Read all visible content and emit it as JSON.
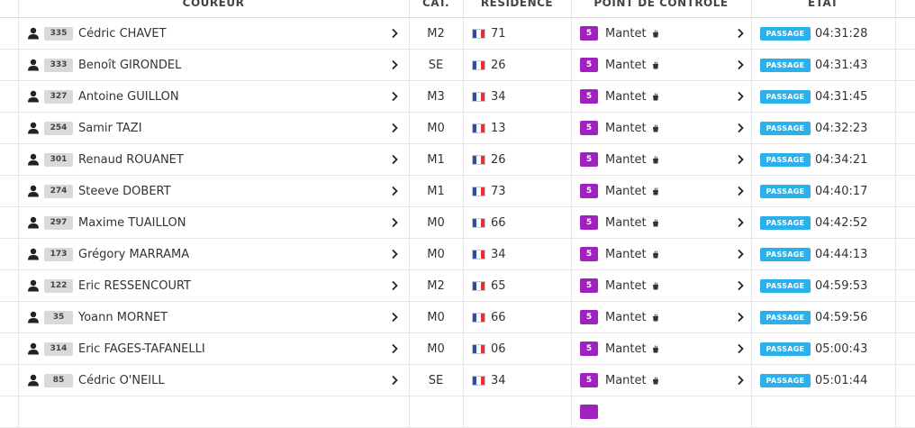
{
  "header": {
    "runner": "COUREUR",
    "category": "CAT.",
    "residence": "RÉSIDENCE",
    "checkpoint": "POINT DE CONTRÔLE",
    "state": "ÉTAT"
  },
  "colors": {
    "checkpoint_badge": "#a020c0",
    "state_badge": "#2ab0ea",
    "bib_badge": "#d9d9d9"
  },
  "icons": {
    "runner": "user-icon",
    "detail": "chevron-right-icon",
    "residence": "french-flag-icon",
    "checkpoint": "food-station-icon"
  },
  "rows": [
    {
      "bib": "335",
      "name": "Cédric CHAVET",
      "cat": "M2",
      "dept": "71",
      "cp_num": "5",
      "cp_name": "Mantet",
      "state": "PASSAGE",
      "time": "04:31:28"
    },
    {
      "bib": "333",
      "name": "Benoît GIRONDEL",
      "cat": "SE",
      "dept": "26",
      "cp_num": "5",
      "cp_name": "Mantet",
      "state": "PASSAGE",
      "time": "04:31:43"
    },
    {
      "bib": "327",
      "name": "Antoine GUILLON",
      "cat": "M3",
      "dept": "34",
      "cp_num": "5",
      "cp_name": "Mantet",
      "state": "PASSAGE",
      "time": "04:31:45"
    },
    {
      "bib": "254",
      "name": "Samir TAZI",
      "cat": "M0",
      "dept": "13",
      "cp_num": "5",
      "cp_name": "Mantet",
      "state": "PASSAGE",
      "time": "04:32:23"
    },
    {
      "bib": "301",
      "name": "Renaud ROUANET",
      "cat": "M1",
      "dept": "26",
      "cp_num": "5",
      "cp_name": "Mantet",
      "state": "PASSAGE",
      "time": "04:34:21"
    },
    {
      "bib": "274",
      "name": "Steeve DOBERT",
      "cat": "M1",
      "dept": "73",
      "cp_num": "5",
      "cp_name": "Mantet",
      "state": "PASSAGE",
      "time": "04:40:17"
    },
    {
      "bib": "297",
      "name": "Maxime TUAILLON",
      "cat": "M0",
      "dept": "66",
      "cp_num": "5",
      "cp_name": "Mantet",
      "state": "PASSAGE",
      "time": "04:42:52"
    },
    {
      "bib": "173",
      "name": "Grégory MARRAMA",
      "cat": "M0",
      "dept": "34",
      "cp_num": "5",
      "cp_name": "Mantet",
      "state": "PASSAGE",
      "time": "04:44:13"
    },
    {
      "bib": "122",
      "name": "Eric RESSENCOURT",
      "cat": "M2",
      "dept": "65",
      "cp_num": "5",
      "cp_name": "Mantet",
      "state": "PASSAGE",
      "time": "04:59:53"
    },
    {
      "bib": "35",
      "name": "Yoann MORNET",
      "cat": "M0",
      "dept": "66",
      "cp_num": "5",
      "cp_name": "Mantet",
      "state": "PASSAGE",
      "time": "04:59:56"
    },
    {
      "bib": "314",
      "name": "Eric FAGES-TAFANELLI",
      "cat": "M0",
      "dept": "06",
      "cp_num": "5",
      "cp_name": "Mantet",
      "state": "PASSAGE",
      "time": "05:00:43"
    },
    {
      "bib": "85",
      "name": "Cédric O'NEILL",
      "cat": "SE",
      "dept": "34",
      "cp_num": "5",
      "cp_name": "Mantet",
      "state": "PASSAGE",
      "time": "05:01:44"
    },
    {
      "bib": "",
      "name": "",
      "cat": "",
      "dept": "",
      "cp_num": "",
      "cp_name": "",
      "state": "",
      "time": ""
    }
  ]
}
